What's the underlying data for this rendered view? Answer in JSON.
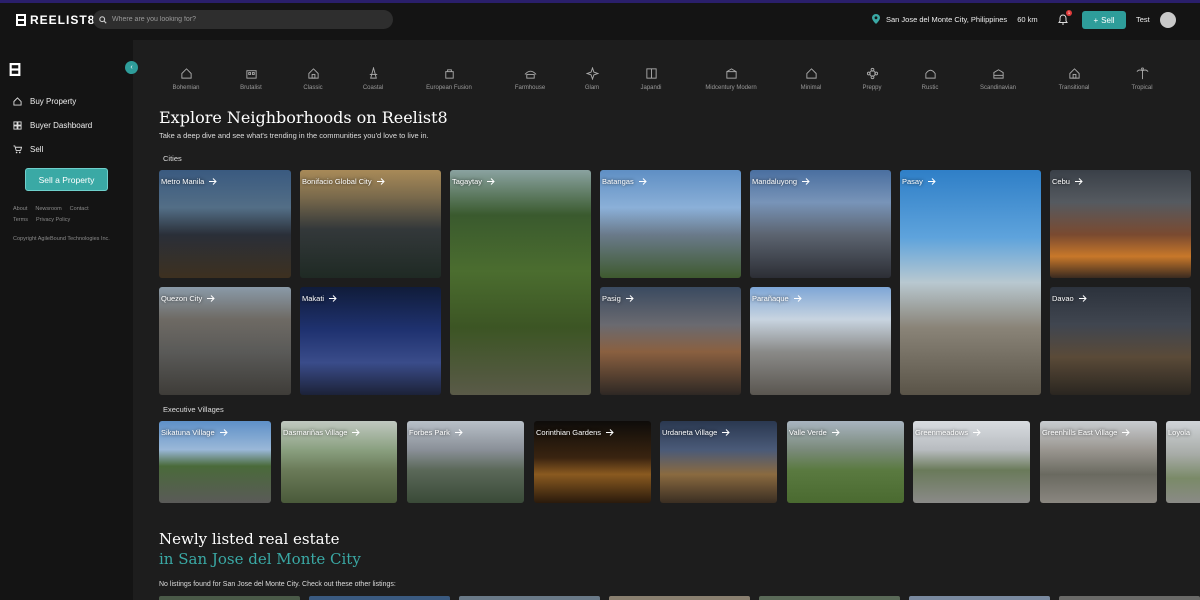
{
  "header": {
    "logo_text": "REELIST8",
    "search_placeholder": "Where are you looking for?",
    "location": "San Jose del Monte City, Philippines",
    "radius": "60 km",
    "notification_count": "1",
    "sell_label": "Sell",
    "user_name": "Test"
  },
  "sidebar": {
    "items": [
      {
        "label": "Buy Property",
        "icon": "home-icon"
      },
      {
        "label": "Buyer Dashboard",
        "icon": "dashboard-icon"
      },
      {
        "label": "Sell",
        "icon": "cart-icon"
      }
    ],
    "sell_property_label": "Sell a Property",
    "footer_links_row1": [
      "About",
      "Newsroom",
      "Contact"
    ],
    "footer_links_row2": [
      "Terms",
      "Privacy Policy"
    ],
    "copyright": "Copyright AgileBound Technologies Inc."
  },
  "styles": [
    "Bohemian",
    "Brutalist",
    "Classic",
    "Coastal",
    "European Fusion",
    "Farmhouse",
    "Glam",
    "Japandi",
    "Midcentury Modern",
    "Minimal",
    "Preppy",
    "Rustic",
    "Scandinavian",
    "Transitional",
    "Tropical"
  ],
  "explore": {
    "title": "Explore Neighborhoods on Reelist8",
    "subtitle": "Take a deep dive and see what's trending in the communities you'd love to live in.",
    "cities_label": "Cities",
    "cities": [
      "Metro Manila",
      "Bonifacio Global City",
      "Tagaytay",
      "Batangas",
      "Mandaluyong",
      "Pasay",
      "Cebu",
      "Quezon City",
      "Makati",
      "Pasig",
      "Parañaque",
      "Davao"
    ],
    "villages_label": "Executive Villages",
    "villages": [
      "Sikatuna Village",
      "Dasmariñas Village",
      "Forbes Park",
      "Corinthian Gardens",
      "Urdaneta Village",
      "Valle Verde",
      "Greenmeadows",
      "Greenhills East Village",
      "Loyola"
    ]
  },
  "listings": {
    "title_line1": "Newly listed real estate",
    "title_line2": "in San Jose del Monte City",
    "empty_message": "No listings found for San Jose del Monte City. Check out these other listings:"
  },
  "colors": {
    "accent": "#3aa9a5",
    "background": "#1d1d1d",
    "sidebar": "#141414"
  }
}
